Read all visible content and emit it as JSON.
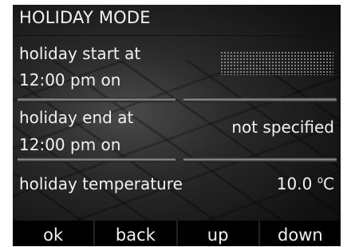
{
  "title": "HOLIDAY MODE",
  "rows": [
    {
      "label_line1": "holiday start at",
      "label_line2": "12:00 pm on",
      "value": ""
    },
    {
      "label_line1": "holiday end at",
      "label_line2": "12:00 pm on",
      "value": "not specified"
    },
    {
      "label_line1": "holiday temperature",
      "value": "10.0",
      "value_unit_sup": "o",
      "value_unit": "C"
    }
  ],
  "softkeys": [
    "ok",
    "back",
    "up",
    "down"
  ]
}
